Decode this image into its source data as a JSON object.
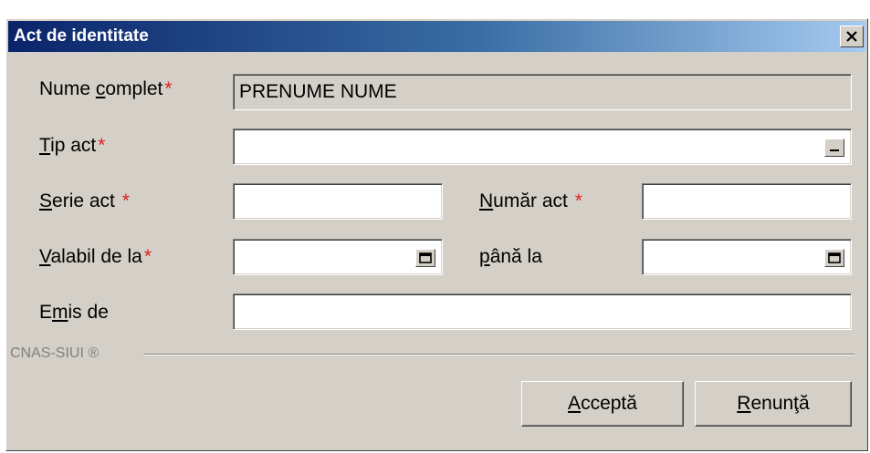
{
  "window": {
    "title": "Act de identitate",
    "close_icon": "close-icon"
  },
  "form": {
    "full_name": {
      "label_accel": "Nume ",
      "label_u": "c",
      "label_rest": "omplet",
      "required": "*",
      "value": "PRENUME NUME"
    },
    "doc_type": {
      "label_u": "T",
      "label_rest": "ip act",
      "required": "*",
      "value": "",
      "button_icon": "dropdown-ellipsis-icon"
    },
    "series": {
      "label_u": "S",
      "label_rest": "erie act ",
      "required": "*",
      "value": ""
    },
    "number": {
      "label_u": "N",
      "label_rest": "umăr act ",
      "required": "*",
      "value": ""
    },
    "valid_from": {
      "label_u": "V",
      "label_rest": "alabil de la",
      "required": "*",
      "value": "",
      "button_icon": "calendar-icon"
    },
    "valid_to": {
      "label_u": "p",
      "label_rest": "ână la",
      "value": "",
      "button_icon": "calendar-icon"
    },
    "issued_by": {
      "label_pre": "E",
      "label_u": "m",
      "label_rest": "is de",
      "value": ""
    }
  },
  "footer": {
    "brand": "CNAS-SIUI ®"
  },
  "buttons": {
    "accept": {
      "u": "A",
      "rest": "cceptă"
    },
    "cancel": {
      "u": "R",
      "rest": "enunţă"
    }
  }
}
